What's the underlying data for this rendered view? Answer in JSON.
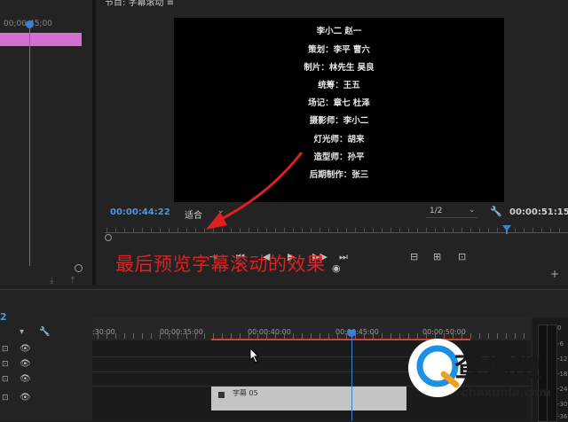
{
  "source_panel": {
    "timecode": "00;00;45;00",
    "bottom_icons": "⤓ ⤒"
  },
  "program_monitor": {
    "tab_title": "节目: 字幕滚动 ≡",
    "credits": [
      "李小二 赵一",
      "策划：李平 曹六",
      "制片：林先生 吴良",
      "统筹：王五",
      "场记：章七 杜泽",
      "摄影师：李小二",
      "灯光师：胡来",
      "造型师：孙平",
      "后期制作：张三"
    ],
    "current_timecode": "00:00:44:22",
    "fit_label": "适合",
    "resolution": "1/2",
    "duration_timecode": "00:00:51:15",
    "controls": [
      "⇥",
      "⏮",
      "◀",
      "▶",
      "▶▶",
      "⏭",
      "⊟",
      "⊞",
      "⊡",
      "◉"
    ],
    "extra_button": "+"
  },
  "annotation": {
    "text": "最后预览字幕滚动的效果",
    "color": "#e02020"
  },
  "timeline": {
    "sequence_number": "2",
    "ruler_labels": [
      ":30:00",
      "00:00:35:00",
      "00:00:40:00",
      "00:00:45:00",
      "00:00:50:00"
    ],
    "tracks": [
      {
        "icon": "⊡",
        "eye": "👁"
      },
      {
        "icon": "⊡",
        "eye": "👁"
      },
      {
        "icon": "⊡",
        "eye": "👁"
      },
      {
        "icon": "⊡",
        "eye": "👁"
      }
    ],
    "clip_label": "字幕 05",
    "vu_labels": [
      "0",
      "-6",
      "-12",
      "-18",
      "-24",
      "-30",
      "-36"
    ]
  },
  "watermark": {
    "brand": "查询啦",
    "url": "chaxunla.com"
  },
  "colors": {
    "accent_blue": "#3b7fd6",
    "clip_magenta": "#d46fd2",
    "work_area_red": "#d6402c"
  }
}
